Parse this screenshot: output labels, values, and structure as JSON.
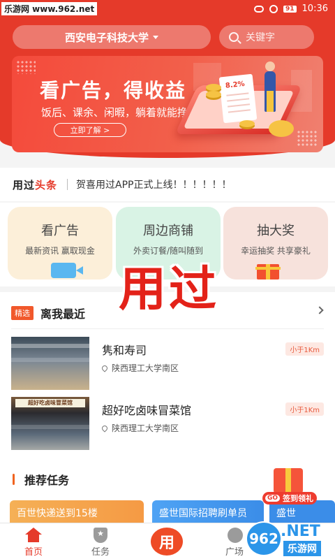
{
  "status_bar": {
    "watermark": "乐游网 www.962.net",
    "battery": "91",
    "time": "10:36"
  },
  "header": {
    "school": "西安电子科技大学",
    "search_placeholder": "关键字"
  },
  "banner": {
    "title": "看广告，得收益",
    "subtitle": "饭后、课余、闲暇，躺着就能挣钱！",
    "button": "立即了解 >",
    "receipt_value": "8.2%"
  },
  "headline": {
    "logo_prefix": "用过",
    "logo_suffix": "头条",
    "text": "贺喜用过APP正式上线！！！！！！"
  },
  "feature_cards": [
    {
      "title": "看广告",
      "subtitle": "最新资讯 赢取现金",
      "icon": "camera-icon"
    },
    {
      "title": "周边商铺",
      "subtitle": "外卖订餐/随叫随到",
      "icon": "store-icon"
    },
    {
      "title": "抽大奖",
      "subtitle": "幸运抽奖 共享豪礼",
      "icon": "gift-icon"
    }
  ],
  "overlay_text": "用过",
  "nearby": {
    "tag": "精选",
    "title": "离我最近",
    "shops": [
      {
        "name": "隽和寿司",
        "location": "陕西理工大学南区",
        "distance": "小于1Km"
      },
      {
        "name": "超好吃卤味冒菜馆",
        "location": "陕西理工大学南区",
        "distance": "小于1Km",
        "sign": "超好吃卤味冒菜馆"
      }
    ]
  },
  "recommend": {
    "title": "推荐任务",
    "tasks": [
      "百世快递送到15楼",
      "盛世国际招聘刷单员",
      "盛世"
    ]
  },
  "sign_badge": {
    "go": "GO",
    "label": "签到领礼"
  },
  "tabbar": {
    "home": "首页",
    "task": "任务",
    "center": "用",
    "square": "广场"
  },
  "watermark_bottom": {
    "logo": "962",
    "net": ".NET",
    "cn": "乐游网"
  },
  "colors": {
    "brand_red": "#e53a2a",
    "accent_orange": "#f0631f",
    "task_blue": "#3b8de8"
  }
}
